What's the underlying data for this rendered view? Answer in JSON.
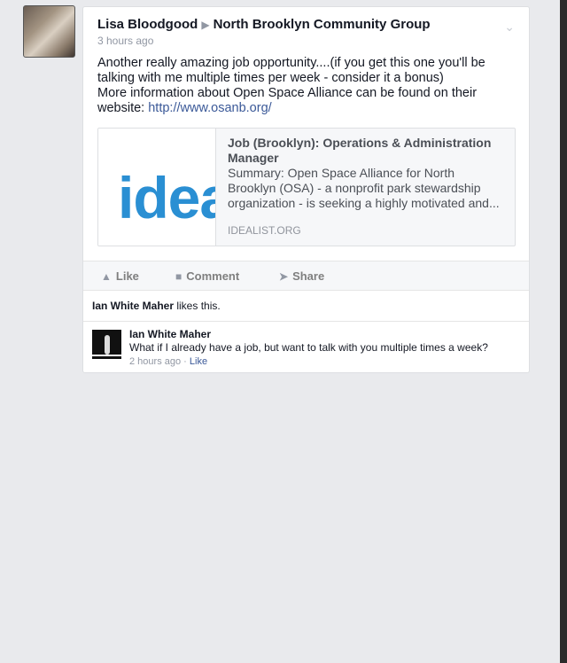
{
  "post": {
    "author": "Lisa Bloodgood",
    "separator": "▶",
    "group": "North Brooklyn Community Group",
    "timestamp": "3 hours ago",
    "text_line1": "Another really amazing job opportunity....(if you get this one you'll be talking with me multiple times per week - consider it a bonus)",
    "text_line2": "More information about Open Space Alliance can be found on their website: ",
    "link_url": "http://www.osanb.org/",
    "options_icon": "chevron-down-icon"
  },
  "link_preview": {
    "thumb_text": "idea",
    "title": "Job (Brooklyn): Operations & Administration Manager",
    "summary": "Summary: Open Space Alliance for North Brooklyn (OSA) - a nonprofit park stewardship organization - is seeking a highly motivated and...",
    "domain": "IDEALIST.ORG"
  },
  "actions": {
    "like": "Like",
    "comment": "Comment",
    "share": "Share",
    "like_icon": "thumbs-up-icon",
    "comment_icon": "speech-bubble-icon",
    "share_icon": "share-arrow-icon"
  },
  "likes": {
    "name": "Ian White Maher",
    "suffix": " likes this."
  },
  "comment": {
    "author": "Ian White Maher",
    "text": "What if I already have a job, but want to talk with you multiple times a week?",
    "time": "2 hours ago",
    "dot": " · ",
    "like": "Like"
  },
  "colors": {
    "background": "#e9eaed",
    "link": "#3b5998",
    "brand_thumb": "#2a8fd3"
  }
}
